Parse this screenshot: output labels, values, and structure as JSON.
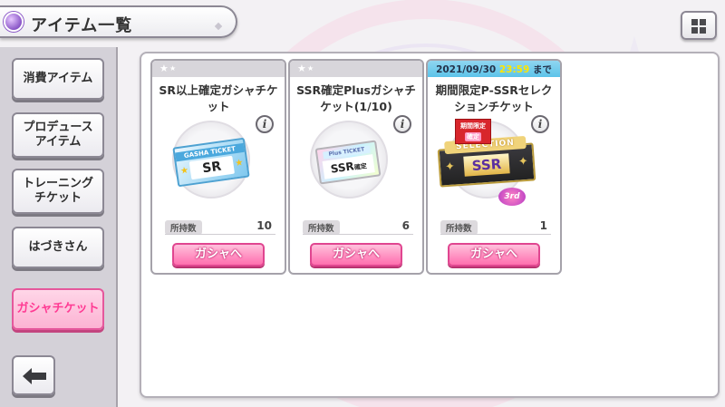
{
  "header": {
    "title": "アイテム一覧",
    "icon": "item-list-icon"
  },
  "top_right": {
    "icon": "grid-view-icon"
  },
  "sidebar": {
    "items": [
      {
        "label": "消費アイテム",
        "active": false
      },
      {
        "label": "プロデュース\nアイテム",
        "active": false
      },
      {
        "label": "トレーニング\nチケット",
        "active": false
      },
      {
        "label": "はづきさん",
        "active": false
      },
      {
        "label": "ガシャチケット",
        "active": true
      }
    ],
    "back_icon": "back-arrow-icon"
  },
  "colors": {
    "accent": "#ff3a93",
    "button_pink": "#ff6eae",
    "deadline_bar": "#5cc3e9",
    "deadline_time": "#ffe600"
  },
  "cards": [
    {
      "name": "SR以上確定ガシャチケット",
      "ticket": {
        "band": "GASHA TICKET",
        "rank": "SR"
      },
      "count_label": "所持数",
      "count": "10",
      "button": "ガシャへ"
    },
    {
      "name": "SSR確定Plusガシャチケット(1/10)",
      "ticket": {
        "band": "Plus TICKET",
        "rank": "SSR",
        "suffix": "確定"
      },
      "count_label": "所持数",
      "count": "6",
      "button": "ガシャへ"
    },
    {
      "deadline": {
        "date": "2021/09/30",
        "time": "23:59",
        "suffix": "まで"
      },
      "name": "期間限定P-SSRセレクションチケット",
      "ticket": {
        "band": "SELECTION",
        "rank": "SSR",
        "tag_line1": "期間限定",
        "tag_line2": "確定",
        "anniv": "3rd"
      },
      "count_label": "所持数",
      "count": "1",
      "button": "ガシャへ"
    }
  ]
}
